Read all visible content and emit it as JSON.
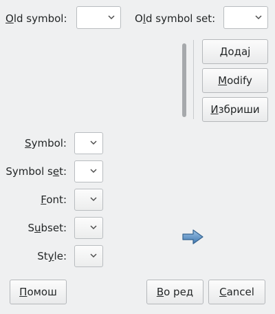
{
  "top": {
    "old_symbol_label_accel": "O",
    "old_symbol_label_rest": "ld symbol:",
    "old_symbol_value": "",
    "old_symbol_set_label_pre": "O",
    "old_symbol_set_label_accel": "l",
    "old_symbol_set_label_rest": "d symbol set:",
    "old_symbol_set_value": ""
  },
  "actions": {
    "add_accel": "Д",
    "add_rest": "одај",
    "modify_accel": "M",
    "modify_rest": "odify",
    "remove_accel": "И",
    "remove_rest": "збриши"
  },
  "form": {
    "symbol_accel": "S",
    "symbol_rest": "ymbol:",
    "symbol_set_pre": "Symbol s",
    "symbol_set_accel": "e",
    "symbol_set_rest": "t:",
    "font_accel": "F",
    "font_rest": "ont:",
    "subset_pre": "S",
    "subset_accel": "u",
    "subset_rest": "bset:",
    "style_pre": "St",
    "style_accel": "y",
    "style_rest": "le:"
  },
  "icons": {
    "arrow": "arrow-right-icon"
  },
  "buttons": {
    "help_accel": "П",
    "help_rest": "омош",
    "ok_accel": "В",
    "ok_rest": "о ред",
    "cancel_accel": "C",
    "cancel_rest": "ancel"
  },
  "colors": {
    "arrow": "#5b8fc2",
    "background": "#eff0f1"
  }
}
